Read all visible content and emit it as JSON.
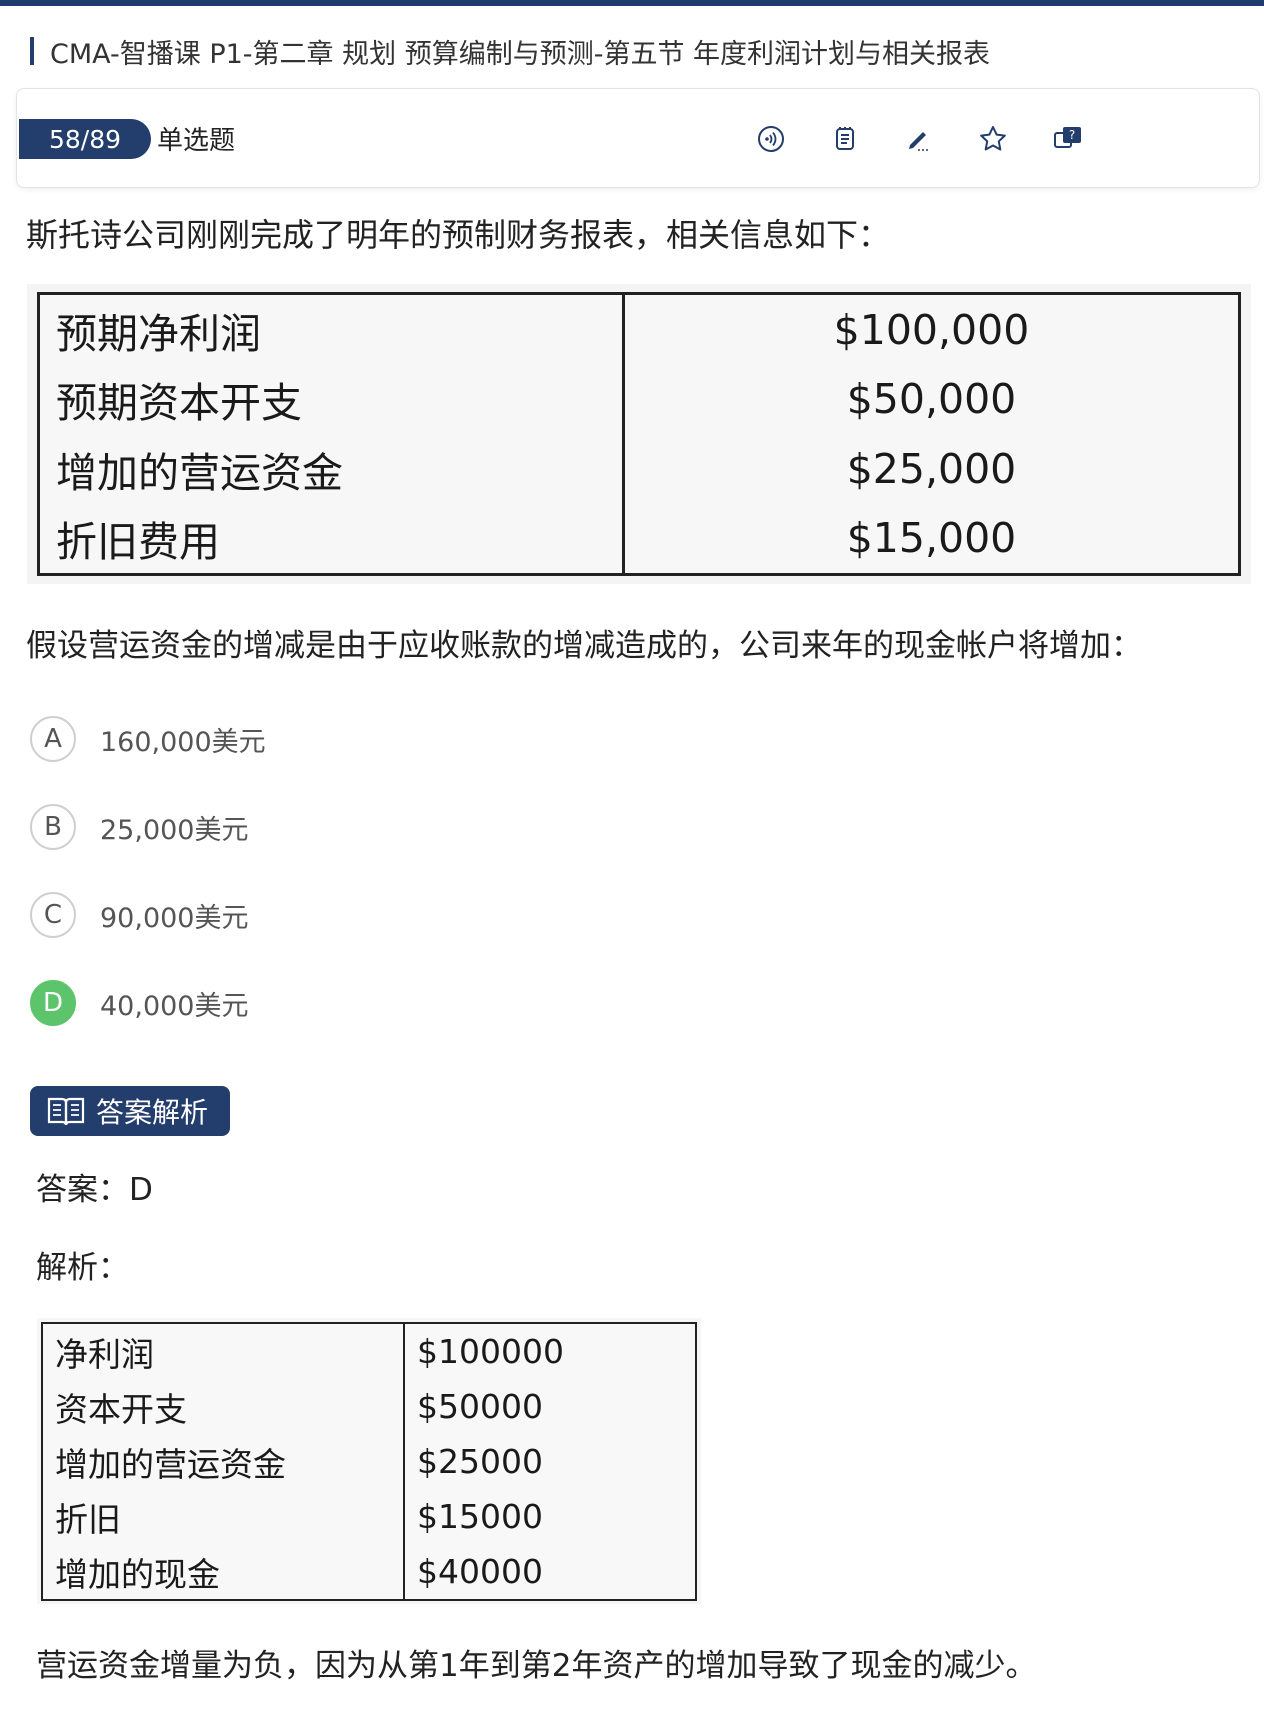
{
  "breadcrumb": {
    "title": "CMA-智播课 P1-第二章 规划 预算编制与预测-第五节 年度利润计划与相关报表"
  },
  "question_bar": {
    "counter": "58/89",
    "type": "单选题",
    "tools": [
      "audio-icon",
      "notes-icon",
      "pencil-icon",
      "star-icon",
      "question-feedback-icon"
    ]
  },
  "stem": "斯托诗公司刚刚完成了明年的预制财务报表，相关信息如下：",
  "table1": {
    "rows": [
      {
        "label": "预期净利润",
        "value": "$100,000"
      },
      {
        "label": "预期资本开支",
        "value": "$50,000"
      },
      {
        "label": "增加的营运资金",
        "value": "$25,000"
      },
      {
        "label": "折旧费用",
        "value": "$15,000"
      }
    ]
  },
  "question": "假设营运资金的增减是由于应收账款的增减造成的，公司来年的现金帐户将增加：",
  "options": [
    {
      "letter": "A",
      "text": "160,000美元"
    },
    {
      "letter": "B",
      "text": "25,000美元"
    },
    {
      "letter": "C",
      "text": "90,000美元"
    },
    {
      "letter": "D",
      "text": "40,000美元"
    }
  ],
  "correct_option": "D",
  "colors": {
    "brand": "#233d6c",
    "correct": "#5ec46b"
  },
  "analysis": {
    "button_label": "答案解析",
    "answer_line": "答案：D",
    "explain_label": "解析：",
    "table2": {
      "rows": [
        {
          "label": "净利润",
          "value": "$100000"
        },
        {
          "label": "资本开支",
          "value": "$50000"
        },
        {
          "label": "增加的营运资金",
          "value": "$25000"
        },
        {
          "label": "折旧",
          "value": "$15000"
        },
        {
          "label": "增加的现金",
          "value": "$40000"
        }
      ]
    },
    "note": "营运资金增量为负，因为从第1年到第2年资产的增加导致了现金的减少。"
  }
}
